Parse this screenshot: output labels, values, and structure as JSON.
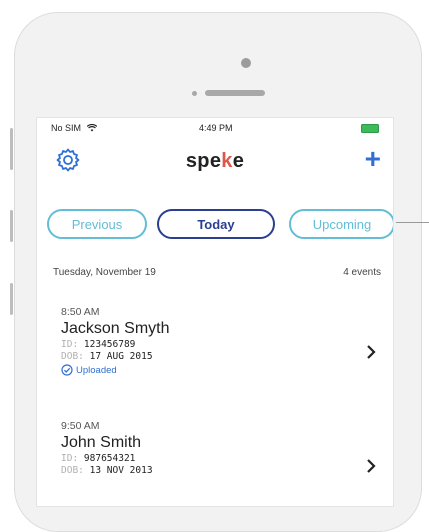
{
  "status_bar": {
    "carrier": "No SIM",
    "time": "4:49 PM"
  },
  "header": {
    "brand_start": "spe",
    "brand_k": "k",
    "brand_end": "e",
    "add_label": "+"
  },
  "tabs": [
    {
      "label": "Previous",
      "active": false
    },
    {
      "label": "Today",
      "active": true
    },
    {
      "label": "Upcoming",
      "active": false
    }
  ],
  "summary": {
    "date": "Tuesday, November 19",
    "count": "4 events"
  },
  "events": [
    {
      "time": "8:50 AM",
      "name": "Jackson Smyth",
      "id_label": "ID:",
      "id": "123456789",
      "dob_label": "DOB:",
      "dob": "17 AUG 2015",
      "status": "Uploaded"
    },
    {
      "time": "9:50 AM",
      "name": "John Smith",
      "id_label": "ID:",
      "id": "987654321",
      "dob_label": "DOB:",
      "dob": "13 NOV 2013"
    }
  ],
  "colors": {
    "accent_blue": "#2f6fd6",
    "tab_outline": "#63bdd6",
    "active_tab": "#2a3f8f",
    "brand_k": "#e0564a",
    "battery": "#3dbb5a"
  },
  "icons": [
    "wifi-icon",
    "battery-icon",
    "gear-icon",
    "plus-icon",
    "chevron-right-icon",
    "check-circle-icon"
  ]
}
